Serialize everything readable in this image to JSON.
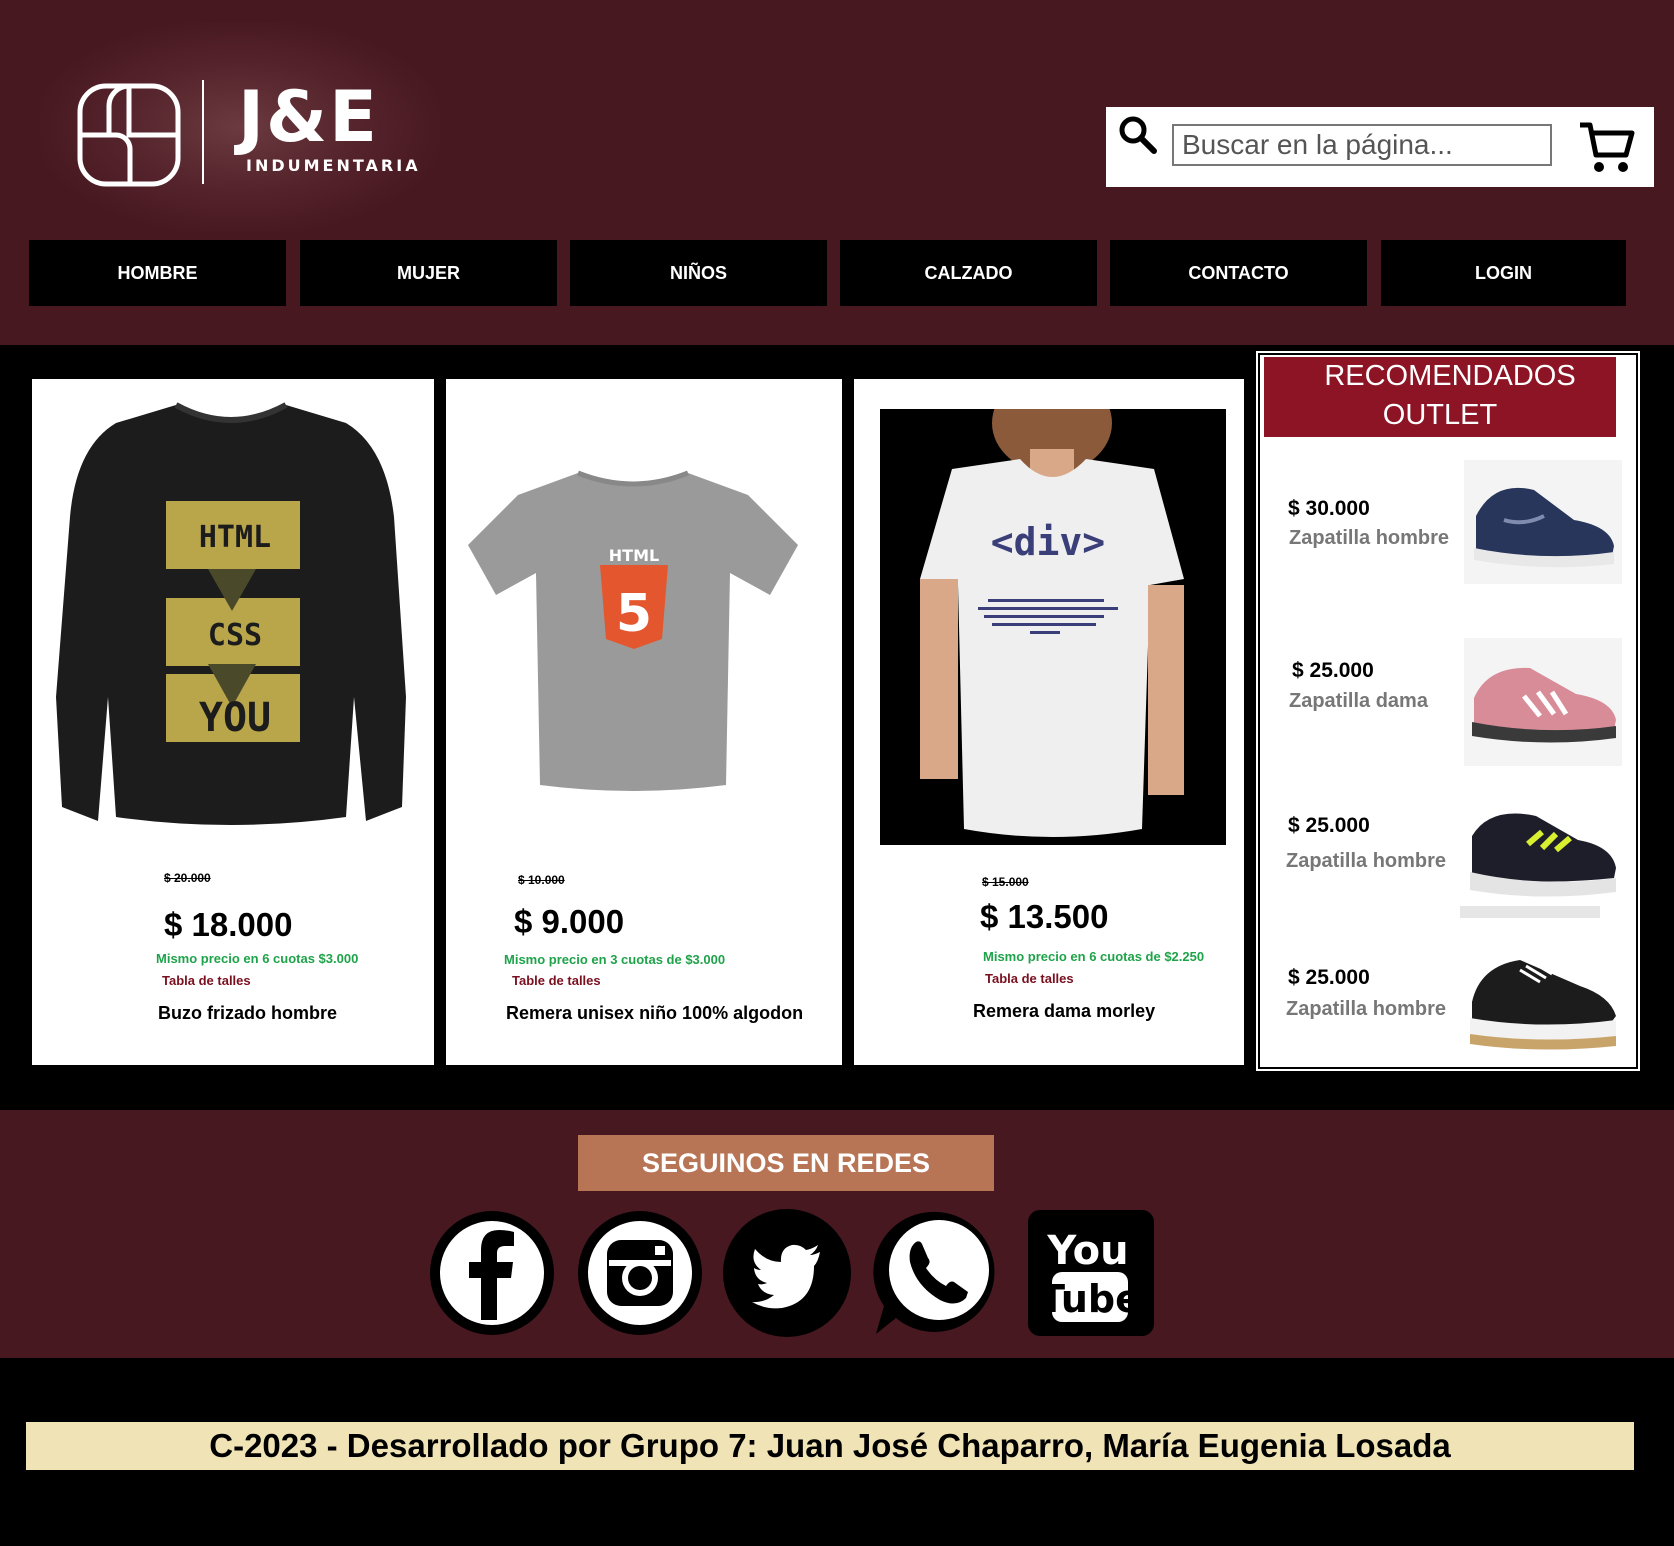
{
  "brand": {
    "name": "J&E",
    "subtitle": "INDUMENTARIA"
  },
  "search": {
    "placeholder": "Buscar en la página..."
  },
  "icons": {
    "search": "search-icon",
    "cart": "shopping-cart-icon",
    "logo": "logo-mark-icon"
  },
  "nav": [
    {
      "label": "HOMBRE"
    },
    {
      "label": "MUJER"
    },
    {
      "label": "NIÑOS"
    },
    {
      "label": "CALZADO"
    },
    {
      "label": "CONTACTO"
    },
    {
      "label": "LOGIN"
    }
  ],
  "products": [
    {
      "old_price": "$ 20.000",
      "price": "$ 18.000",
      "installments": "Mismo precio en 6 cuotas $3.000",
      "sizes": "Tabla de talles",
      "name": "Buzo frizado hombre",
      "print": [
        "HTML",
        "CSS",
        "YOU"
      ]
    },
    {
      "old_price": "$ 10.000",
      "price": "$ 9.000",
      "installments": "Mismo precio en 3 cuotas de $3.000",
      "sizes": "Table de talles",
      "name": "Remera unisex niño 100% algodon",
      "print": [
        "HTML",
        "5"
      ]
    },
    {
      "old_price": "$ 15.000",
      "price": "$ 13.500",
      "installments": "Mismo precio en 6 cuotas de $2.250",
      "sizes": "Tabla de talles",
      "name": "Remera dama morley",
      "print": [
        "<div>"
      ]
    }
  ],
  "outlet": {
    "title_line1": "RECOMENDADOS",
    "title_line2": "OUTLET",
    "items": [
      {
        "price": "$ 30.000",
        "name": "Zapatilla hombre"
      },
      {
        "price": "$ 25.000",
        "name": "Zapatilla dama"
      },
      {
        "price": "$ 25.000",
        "name": "Zapatilla hombre"
      },
      {
        "price": "$ 25.000",
        "name": "Zapatilla hombre"
      }
    ]
  },
  "social": {
    "title": "SEGUINOS EN REDES",
    "networks": [
      "facebook-icon",
      "instagram-icon",
      "twitter-icon",
      "whatsapp-icon",
      "youtube-icon"
    ],
    "youtube_line1": "You",
    "youtube_line2": "Tube"
  },
  "footer": {
    "text": "C-2023 - Desarrollado por Grupo 7: Juan José Chaparro, María Eugenia Losada"
  },
  "colors": {
    "header_bg": "#471820",
    "outlet_header": "#8c1424",
    "social_title": "#b87556",
    "footer_bar": "#f0e3b5",
    "installments": "#1fa34a"
  }
}
